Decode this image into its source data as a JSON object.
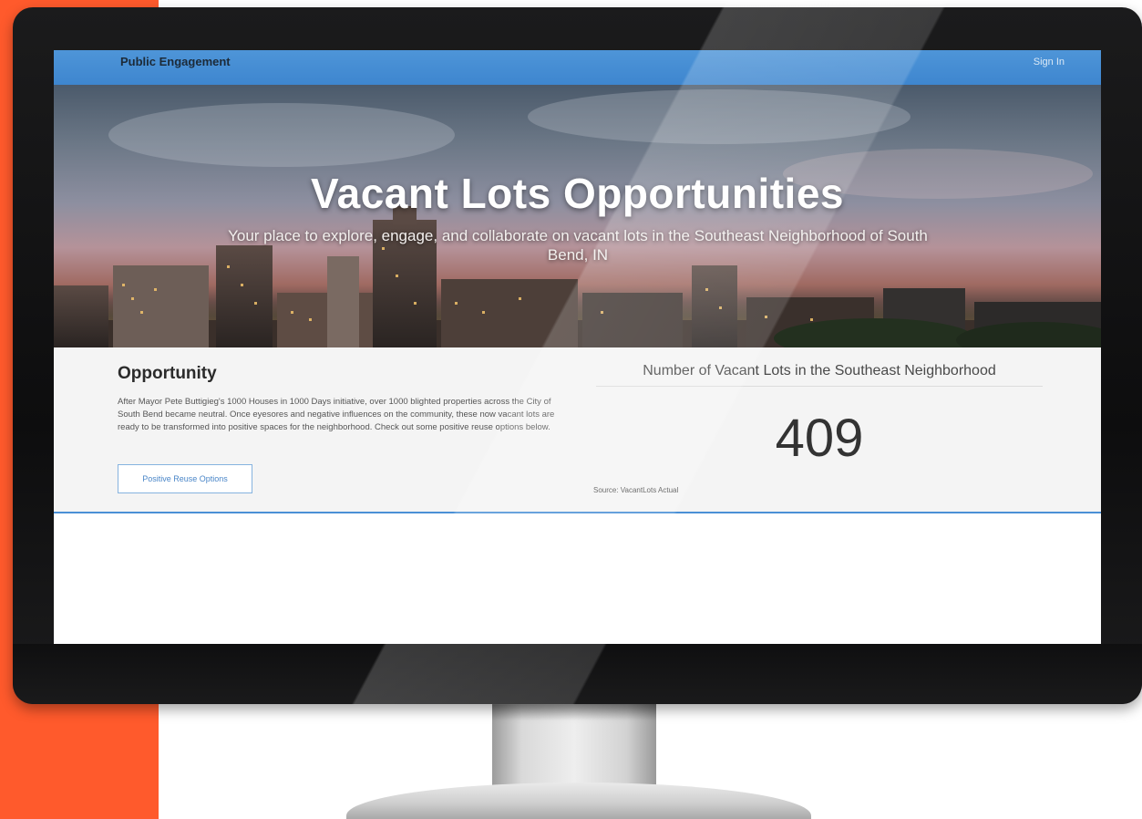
{
  "site": {
    "brand": "Public Engagement",
    "signin_label": "Sign In"
  },
  "hero": {
    "title": "Vacant Lots Opportunities",
    "subtitle": "Your place to explore, engage, and collaborate on vacant lots in the Southeast Neighborhood of South Bend, IN"
  },
  "opportunity": {
    "heading": "Opportunity",
    "body": "After Mayor Pete Buttigieg's 1000 Houses in 1000 Days initiative, over 1000 blighted properties across the City of South Bend became neutral. Once eyesores and negative influences on the community, these now vacant lots are ready to be transformed into positive spaces for the neighborhood. Check out some positive reuse options below.",
    "button_label": "Positive Reuse Options"
  },
  "stat": {
    "title": "Number of Vacant Lots in the Southeast Neighborhood",
    "value": "409",
    "source": "Source: VacantLots Actual"
  },
  "colors": {
    "accent_orange": "#ff5a2c",
    "topbar_blue": "#4e95d8",
    "divider_blue": "#4a90d6"
  }
}
